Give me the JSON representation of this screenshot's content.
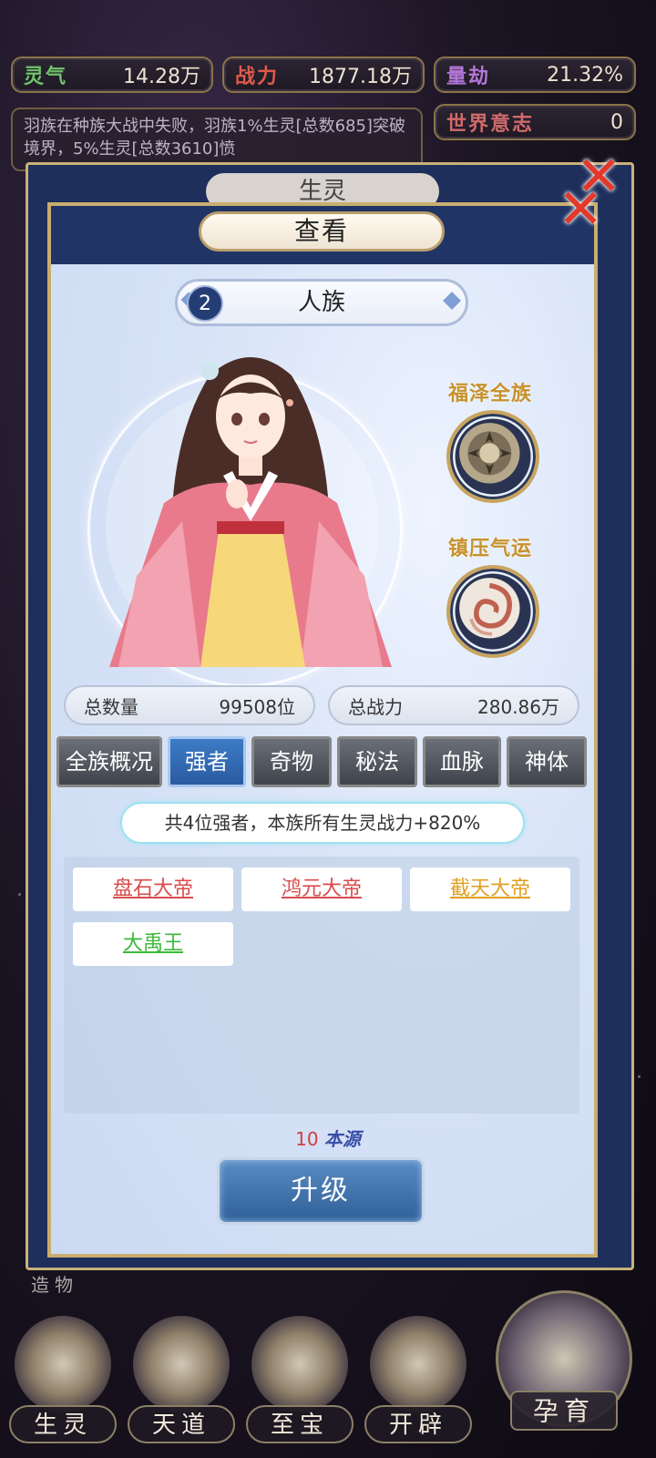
{
  "resources": [
    {
      "key": "灵气",
      "value": "14.28万",
      "color": "#6ec46a"
    },
    {
      "key": "战力",
      "value": "1877.18万",
      "color": "#e05a4a"
    },
    {
      "key": "量劫",
      "value": "21.32%",
      "color": "#b276d8"
    },
    {
      "key": "世界意志",
      "value": "0",
      "color": "#d06a6a"
    }
  ],
  "log_text": "羽族在种族大战中失败，羽族1%生灵[总数685]突破境界，5%生灵[总数3610]愤",
  "back_tab_label": "生灵",
  "dialog": {
    "title": "查看",
    "race": {
      "index": "2",
      "name": "人族"
    },
    "badges": [
      {
        "label": "福泽全族",
        "icon": "fortune-medallion-icon"
      },
      {
        "label": "镇压气运",
        "icon": "swirl-medallion-icon"
      }
    ],
    "stats": {
      "count_label": "总数量",
      "count_value": "99508位",
      "power_label": "总战力",
      "power_value": "280.86万"
    },
    "tabs": [
      "全族概况",
      "强者",
      "奇物",
      "秘法",
      "血脉",
      "神体"
    ],
    "active_tab": "强者",
    "info": "共4位强者，本族所有生灵战力+820%",
    "heroes": [
      {
        "name": "盘石大帝",
        "color": "#d94c4c"
      },
      {
        "name": "鸿元大帝",
        "color": "#d94c4c"
      },
      {
        "name": "截天大帝",
        "color": "#e0a020"
      },
      {
        "name": "大禹王",
        "color": "#3cb83c"
      }
    ],
    "cost_amount": "10",
    "cost_unit": "本源",
    "upgrade_label": "升级"
  },
  "bottom_nav": {
    "left_label": "造物",
    "items": [
      "生灵",
      "天道",
      "至宝",
      "开辟"
    ],
    "special": "孕育"
  }
}
